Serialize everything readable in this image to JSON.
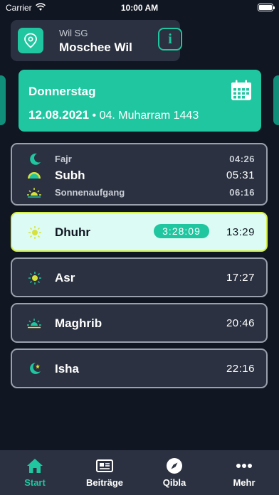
{
  "status_bar": {
    "carrier": "Carrier",
    "time": "10:00 AM",
    "battery_level": 1.0
  },
  "location": {
    "city": "Wil SG",
    "mosque": "Moschee Wil",
    "info_glyph": "i"
  },
  "date_card": {
    "weekday": "Donnerstag",
    "gregorian": "12.08.2021",
    "separator": " • ",
    "hijri": "04. Muharram 1443",
    "icon": "calendar-icon"
  },
  "prayers_group": [
    {
      "name": "Fajr",
      "time": "04:26",
      "icon": "crescent-moon-icon"
    },
    {
      "name": "Subh",
      "time": "05:31",
      "icon": "dawn-icon"
    },
    {
      "name": "Sonnenaufgang",
      "time": "06:16",
      "icon": "sunrise-icon"
    }
  ],
  "prayers": [
    {
      "name": "Dhuhr",
      "time": "13:29",
      "countdown": "3:28:09",
      "icon": "sun-icon",
      "active": true
    },
    {
      "name": "Asr",
      "time": "17:27",
      "icon": "sun-icon"
    },
    {
      "name": "Maghrib",
      "time": "20:46",
      "icon": "sunset-icon"
    },
    {
      "name": "Isha",
      "time": "22:16",
      "icon": "moon-star-icon"
    }
  ],
  "tabs": [
    {
      "label": "Start",
      "icon": "home-icon",
      "active": true
    },
    {
      "label": "Beiträge",
      "icon": "newspaper-icon"
    },
    {
      "label": "Qibla",
      "icon": "compass-icon"
    },
    {
      "label": "Mehr",
      "icon": "more-icon"
    }
  ],
  "colors": {
    "accent": "#20c6a0",
    "background": "#101622",
    "card": "#2b3140",
    "active_row": "#dcfbf4",
    "active_border": "#d6f04a"
  }
}
